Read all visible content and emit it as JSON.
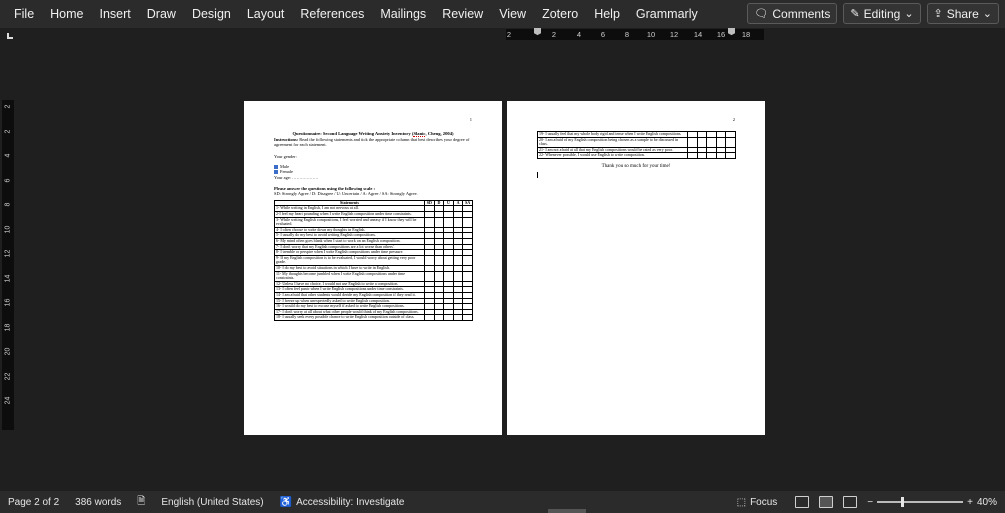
{
  "ribbon": {
    "tabs": [
      "File",
      "Home",
      "Insert",
      "Draw",
      "Design",
      "Layout",
      "References",
      "Mailings",
      "Review",
      "View",
      "Zotero",
      "Help",
      "Grammarly"
    ],
    "comments_label": "Comments",
    "editing_label": "Editing",
    "share_label": "Share"
  },
  "ruler": {
    "h_marks": [
      "2",
      "2",
      "4",
      "6",
      "8",
      "10",
      "12",
      "14",
      "16",
      "18"
    ],
    "v_marks": [
      "2",
      "2",
      "4",
      "6",
      "8",
      "10",
      "12",
      "14",
      "16",
      "18",
      "20",
      "22",
      "24"
    ]
  },
  "page1": {
    "page_number": "1",
    "title_prefix": "Questionnaire: Second Language Writing Anxiety Inventory (",
    "title_author": "Slanic",
    "title_suffix": ", Cheng, 2004)",
    "instructions_label": "Instructions:",
    "instructions_text": " Read the following statements and tick the appropriate column that best describes your degree of agreement for each statement.",
    "gender_label": "Your gender:",
    "gender_options": [
      "Male",
      "Female"
    ],
    "age_label": "Your age: ………………",
    "scale_heading": "Please answer the questions using the following scale :",
    "scale_text": "SD: Strongly Agree / D: Disagree / U: Uncertain / A: Agree / SA: Strongly Agree.",
    "table_headers": [
      "Statements",
      "SD",
      "D",
      "U",
      "A",
      "SA"
    ],
    "statements": [
      "1- While writing in English, I am not nervous at all.",
      "2-I feel my heart pounding when I write English composition under time constraints.",
      "3- While writing English compositions, I feel worried and uneasy if I know they will be evaluated.",
      "4- I often choose to write down my thoughts in English.",
      "5- I usually do my best to avoid writing English compositions.",
      "6- My mind often goes blank when I start to work on an English composition.",
      "7- I don't worry that my English compositions are a lot worse than others'.",
      "8- I tremble or perspire when I write English compositions under time pressure.",
      "9- If my English composition is to be evaluated, I would worry about getting very poor grade.",
      "10- I do my best to avoid situations in which I have to write in English.",
      "11- My thoughts become jumbled when I write English compositions under time constraints.",
      "12- Unless I have no choice, I would not use English to write a composition.",
      "13- I often feel panic when I write English compositions under time constraints.",
      "14- I am afraid that other students would deride my English composition if they read it.",
      "15- I freeze up when unexpectedly asked to write English composition.",
      "16- I would do my best to excuse myself if asked to write English compositions.",
      "17- I don't worry at all about what other people would think of my English compositions.",
      "18- I usually seek every possible chance to write English composition outside of class."
    ]
  },
  "page2": {
    "page_number": "2",
    "statements": [
      "19- I usually feel that my whole body rigid and tense when I write English compositions.",
      "20- I am afraid of my English composition being chosen as a sample to be discussed in class.",
      "21- I am not afraid at all that my English compositions would be rated as very poor.",
      "22- Whenever possible, I would use English to write composition."
    ],
    "thanks": "Thank you so much for your time!"
  },
  "status": {
    "page": "Page 2 of 2",
    "words": "386 words",
    "language": "English (United States)",
    "accessibility": "Accessibility: Investigate",
    "focus": "Focus",
    "zoom": "40%",
    "zoom_fraction": 0.28
  }
}
